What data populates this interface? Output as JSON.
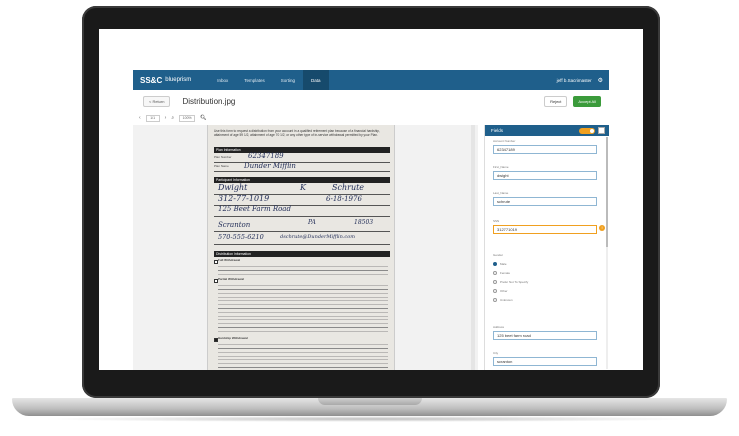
{
  "app": {
    "logo_mark": "SS&C",
    "logo_text": "blueprism",
    "nav": [
      "Inbox",
      "Templates",
      "Sorting",
      "Data"
    ],
    "user": "jeff b.Sacrimaster",
    "back_label": "< Return",
    "doc_title": "Distribution.jpg",
    "reject_label": "Reject",
    "accept_label": "Accept All"
  },
  "toolbar": {
    "page": "1/1",
    "zoom": "100%"
  },
  "document": {
    "intro": "Use this form to request a distribution from your account in a qualified retirement plan because of a financial hardship, attainment of age 59 1/2, attainment of age 70 1/2, or any other type of in-service withdrawal permitted by your Plan.",
    "sections": [
      "Plan Information",
      "Participant Information",
      "Distribution Information"
    ],
    "plan_number": "62347189",
    "plan_name": "Dunder Mifflin",
    "first_name": "Dwight",
    "middle": "K",
    "last_name": "Schrute",
    "ssn": "312-77-1019",
    "dob": "6-18-1976",
    "address": "125 Beet Farm Road",
    "city": "Scranton",
    "state": "PA",
    "zip": "18503",
    "phone": "570-555-6210",
    "email": "dschrute@DunderMifflin.com",
    "opt1": "Full Withdrawal",
    "opt2": "Partial Withdrawal",
    "opt3": "Hardship Withdrawal"
  },
  "panel": {
    "title": "Fields",
    "fields": [
      {
        "label": "Account Number",
        "value": "62347189"
      },
      {
        "label": "First_Name",
        "value": "dwight"
      },
      {
        "label": "Last_Name",
        "value": "schrute"
      },
      {
        "label": "SSN",
        "value": "312771019"
      }
    ],
    "gender_label": "Gender",
    "gender_options": [
      "Male",
      "Female",
      "Prefer Not To Specify",
      "Other",
      "Unknown"
    ],
    "address_label": "Address",
    "address_value": "125 beet farm road",
    "city_label": "City",
    "city_value": "scranton"
  }
}
